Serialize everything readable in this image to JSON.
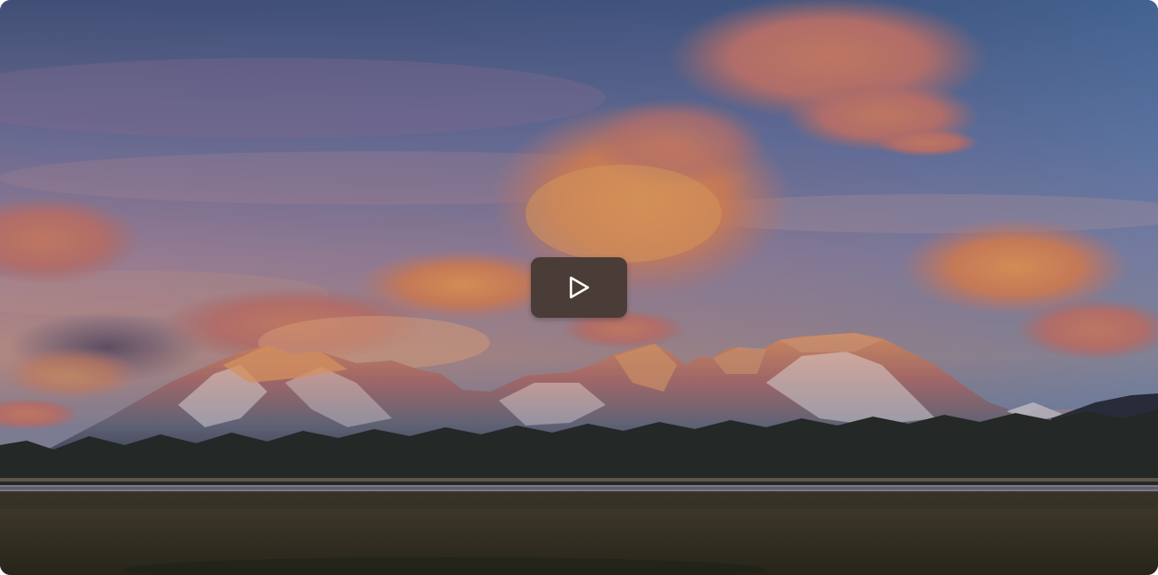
{
  "player": {
    "play_label": "",
    "colors": {
      "play_button_bg": "#4a3c36",
      "play_icon": "#ffffff"
    },
    "icons": {
      "play": "play-triangle-icon"
    },
    "poster": {
      "subject": "mountain-range-at-sunset"
    }
  }
}
